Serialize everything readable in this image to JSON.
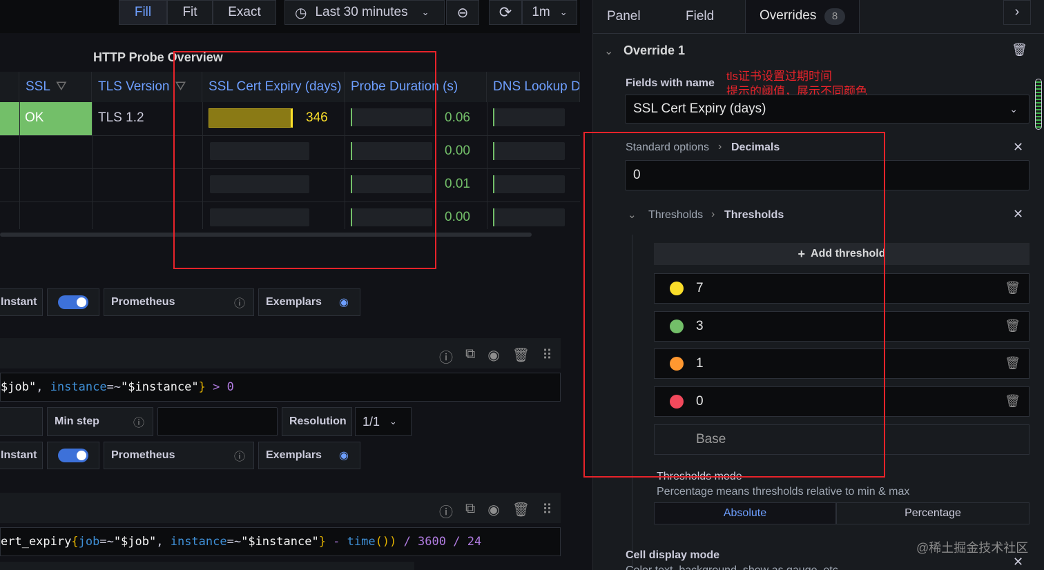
{
  "toolbar": {
    "fill": "Fill",
    "fit": "Fit",
    "exact": "Exact",
    "time_range": "Last 30 minutes",
    "refresh_interval": "1m"
  },
  "panel": {
    "title": "HTTP Probe Overview",
    "columns": [
      "SSL",
      "TLS Version",
      "SSL Cert Expiry (days)",
      "Probe Duration (s)",
      "DNS Lookup D"
    ],
    "rows": [
      {
        "ssl": "OK",
        "tls": "TLS 1.2",
        "expiry": "346",
        "duration": "0.06"
      },
      {
        "ssl": "",
        "tls": "",
        "expiry": "",
        "duration": "0.00"
      },
      {
        "ssl": "",
        "tls": "",
        "expiry": "",
        "duration": "0.01"
      },
      {
        "ssl": "",
        "tls": "",
        "expiry": "",
        "duration": "0.00"
      }
    ]
  },
  "queries": {
    "row1": {
      "instant": "Instant",
      "datasource": "Prometheus",
      "exemplars": "Exemplars"
    },
    "query1_code": {
      "p1": "$job\"",
      "p2": ", ",
      "p3": "instance",
      "p4": "=~",
      "p5": "\"$instance\"",
      "p6": "}",
      "p7": " > ",
      "p8": "0"
    },
    "row2": {
      "min_step": "Min step",
      "resolution": "Resolution",
      "resolution_value": "1/1"
    },
    "row3": {
      "instant": "Instant",
      "datasource": "Prometheus",
      "exemplars": "Exemplars"
    },
    "query2_code": {
      "p1": "ert_expiry",
      "p2": "{",
      "p3": "job",
      "p4": "=~",
      "p5": "\"$job\"",
      "p6": ", ",
      "p7": "instance",
      "p8": "=~",
      "p9": "\"$instance\"",
      "p10": "}",
      "p11": " - ",
      "p12": "time",
      "p13": "())",
      "p14": " / ",
      "p15": "3600",
      "p16": " / ",
      "p17": "24"
    }
  },
  "editor": {
    "tabs": {
      "panel": "Panel",
      "field": "Field",
      "overrides": "Overrides",
      "overrides_count": "8"
    },
    "override_title": "Override 1",
    "fields_with_name_label": "Fields with name",
    "fields_with_name_value": "SSL Cert Expiry (days)",
    "annotation_line1": "tls证书设置过期时间",
    "annotation_line2": "提示的阈值，展示不同颜色",
    "standard_options": "Standard options",
    "decimals": "Decimals",
    "decimals_value": "0",
    "thresholds_group": "Thresholds",
    "thresholds_item": "Thresholds",
    "add_threshold": "Add threshold",
    "thresholds": [
      {
        "value": "7",
        "color": "#fade2a"
      },
      {
        "value": "3",
        "color": "#73bf69"
      },
      {
        "value": "1",
        "color": "#ff9830"
      },
      {
        "value": "0",
        "color": "#f2495c"
      }
    ],
    "base": "Base",
    "thresholds_mode_label": "Thresholds mode",
    "thresholds_mode_desc": "Percentage means thresholds relative to min & max",
    "mode_absolute": "Absolute",
    "mode_percentage": "Percentage",
    "cell_display_mode": "Cell display mode",
    "cell_display_desc": "Color text, background, show as gauge, etc",
    "watermark": "@稀土掘金技术社区"
  }
}
